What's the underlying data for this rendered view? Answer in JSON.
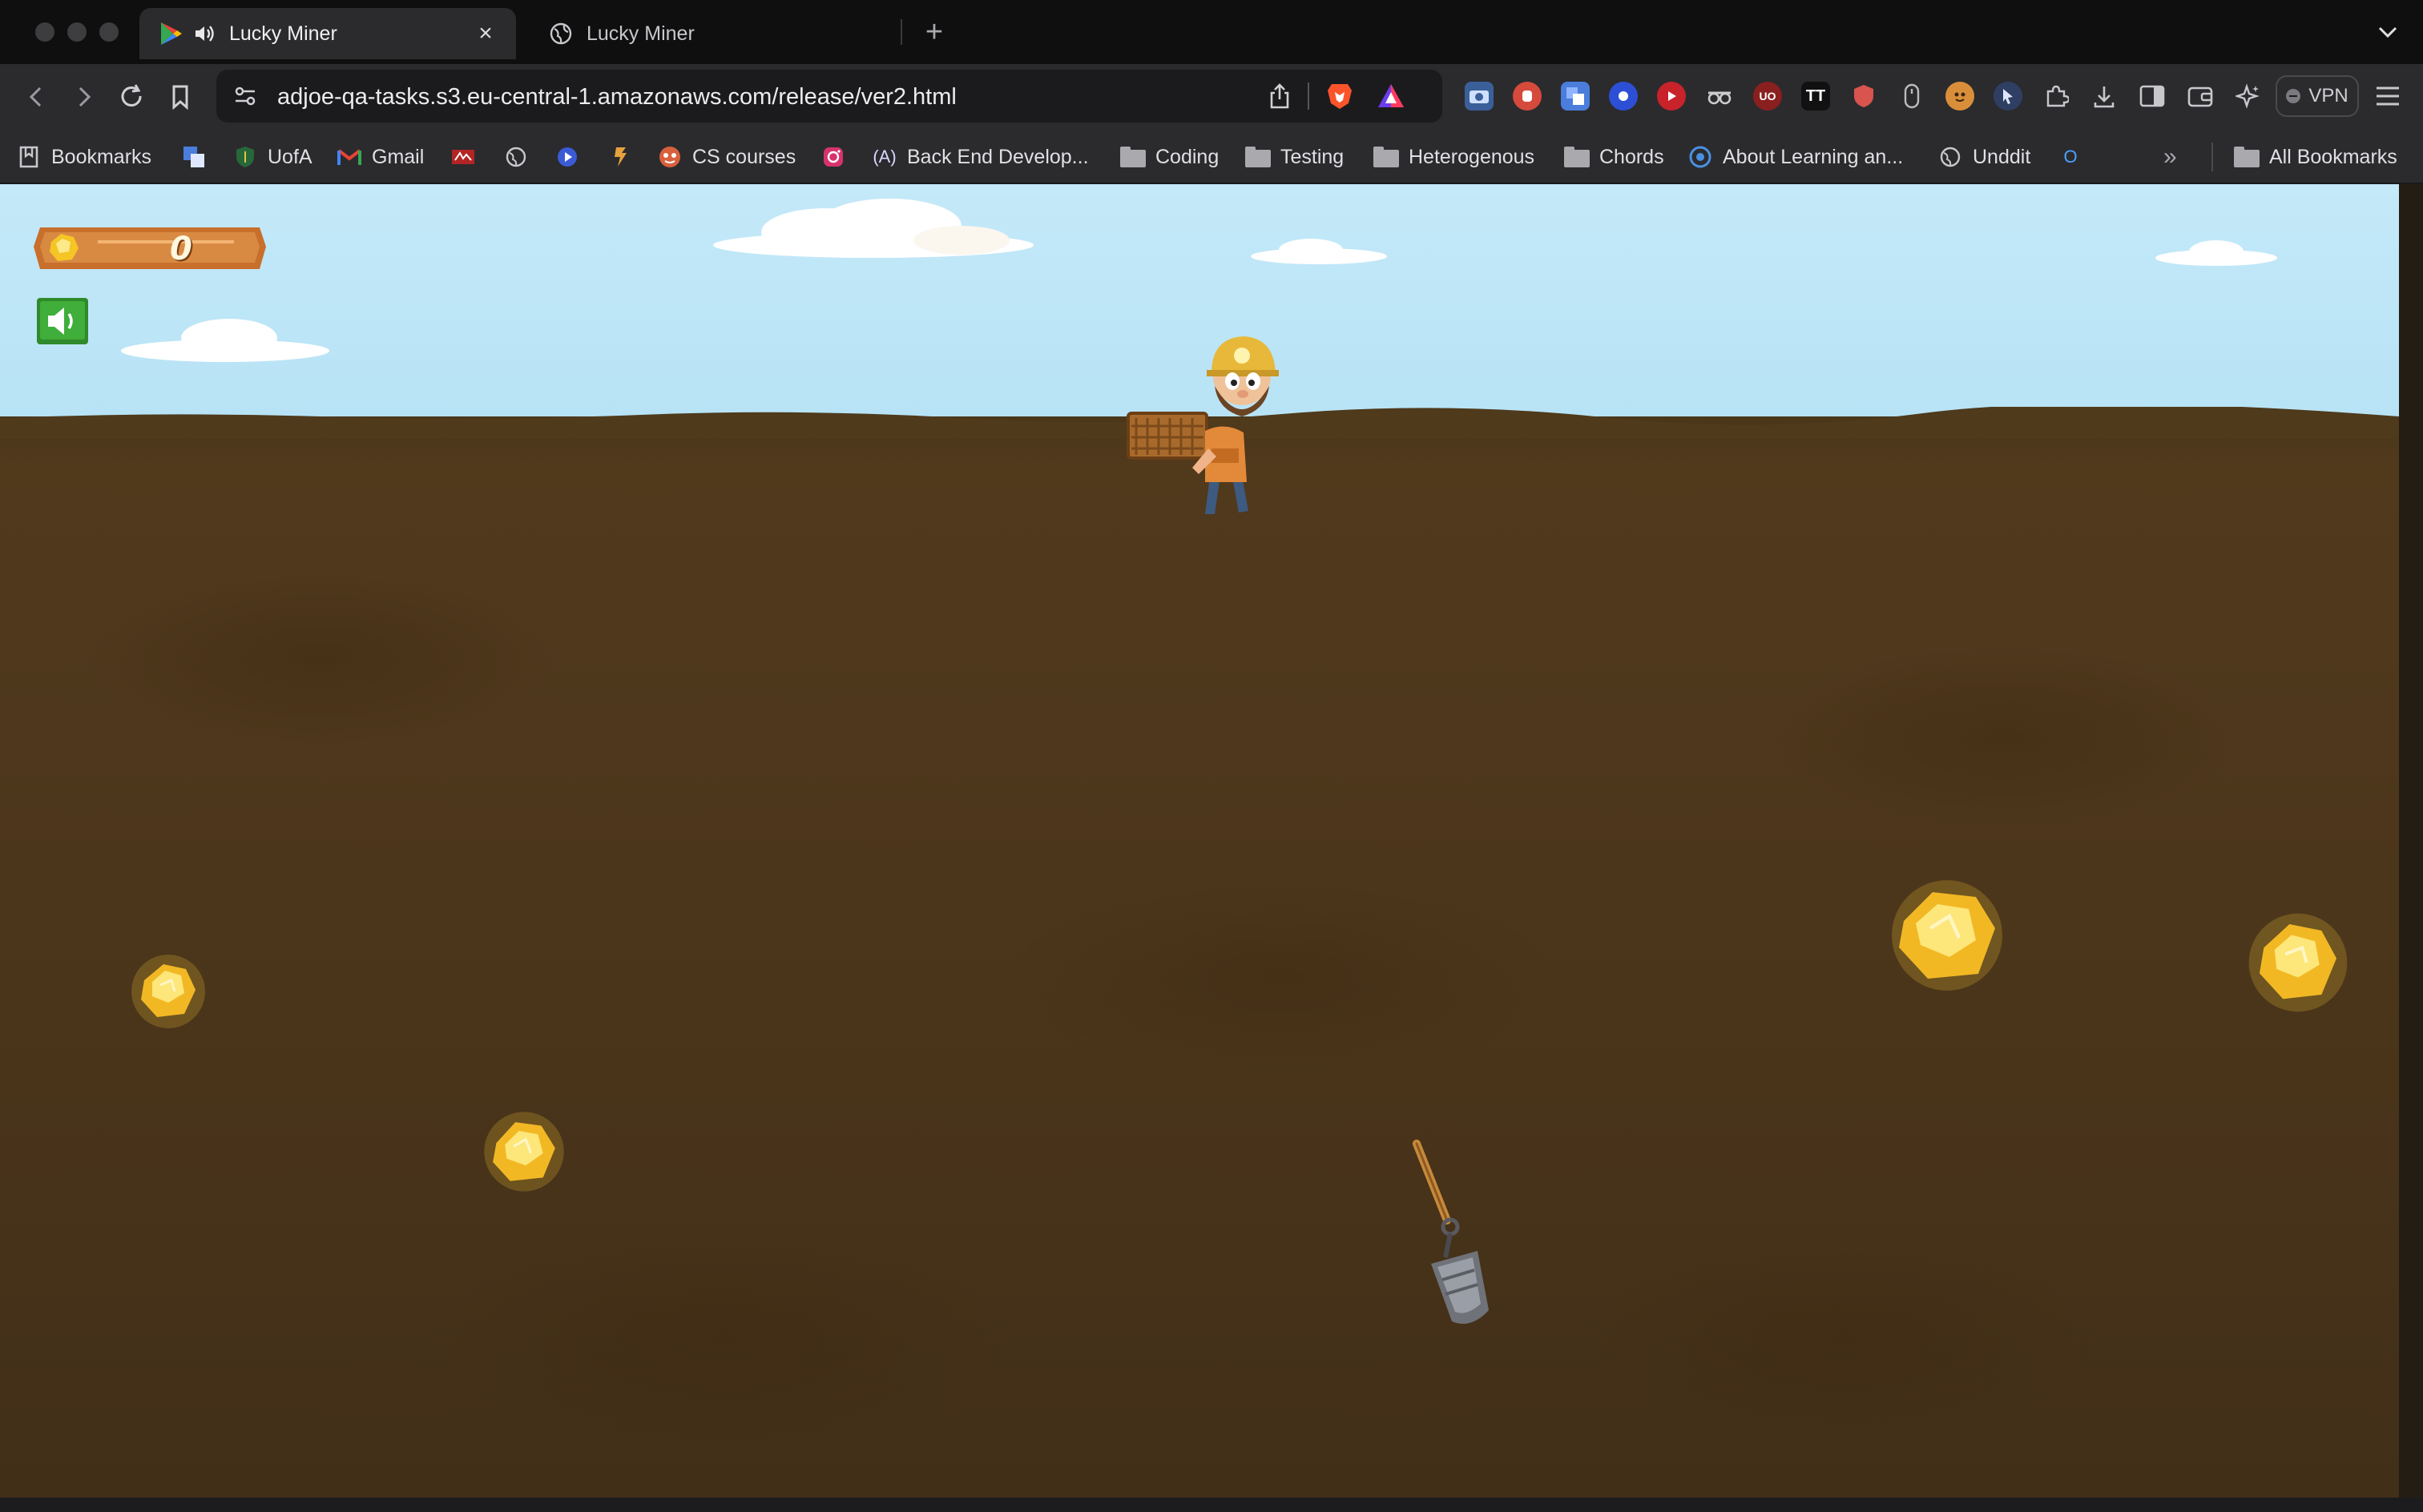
{
  "browser": {
    "tabs": [
      {
        "title": "Lucky Miner",
        "active": true,
        "audio": true
      },
      {
        "title": "Lucky Miner",
        "active": false,
        "audio": false
      }
    ],
    "tab_close_glyph": "×",
    "new_tab_glyph": "+",
    "address": {
      "url": "adjoe-qa-tasks.s3.eu-central-1.amazonaws.com/release/ver2.html"
    },
    "vpn_label": "VPN",
    "extensions": [
      "screenshot-icon",
      "stop-hand-icon",
      "translate-icon",
      "circle-ext-icon",
      "play-ext-icon",
      "spy-glasses-icon",
      "ublock-icon",
      "tt-ext-icon",
      "shield-ext-icon",
      "mouse-icon",
      "face-ext-icon",
      "cursor-ext-icon",
      "puzzle-icon",
      "download-icon",
      "sidebar-icon",
      "wallet-icon",
      "leo-ai-icon"
    ],
    "ext_labels": {
      "ublock": "UO",
      "tt": "TT"
    }
  },
  "bookmarks": {
    "items": [
      {
        "label": "Bookmarks",
        "icon": "bookmarks-icon"
      },
      {
        "label": "",
        "icon": "translate-bm-icon"
      },
      {
        "label": "UofA",
        "icon": "shield-bm-icon"
      },
      {
        "label": "Gmail",
        "icon": "gmail-icon"
      },
      {
        "label": "",
        "icon": "red-site-icon"
      },
      {
        "label": "",
        "icon": "globe-icon"
      },
      {
        "label": "",
        "icon": "play-bm-icon"
      },
      {
        "label": "",
        "icon": "flag-bm-icon"
      },
      {
        "label": "CS courses",
        "icon": "cs-courses-icon"
      },
      {
        "label": "",
        "icon": "instagram-icon"
      },
      {
        "label": "Back End Develop...",
        "icon": "backend-icon"
      },
      {
        "label": "Coding",
        "icon": "folder-icon"
      },
      {
        "label": "Testing",
        "icon": "folder-icon"
      },
      {
        "label": "Heterogenous",
        "icon": "folder-icon"
      },
      {
        "label": "Chords",
        "icon": "folder-icon"
      },
      {
        "label": "About Learning an...",
        "icon": "learning-icon"
      },
      {
        "label": "Unddit",
        "icon": "globe-icon"
      },
      {
        "label": "",
        "icon": "o-bm-icon"
      }
    ],
    "overflow_glyph": "»",
    "all_bookmarks": "All Bookmarks",
    "backend_badge": "(A)",
    "o_badge": "O"
  },
  "game": {
    "title": "Lucky Miner",
    "score": "0",
    "sound_on": true,
    "nugget_count": 5,
    "colors": {
      "sky": "#b7e3f6",
      "dirt": "#4c361b",
      "gold": "#f5c526",
      "score_panel": "#c86f2c",
      "sound_button": "#3fae3a"
    }
  }
}
